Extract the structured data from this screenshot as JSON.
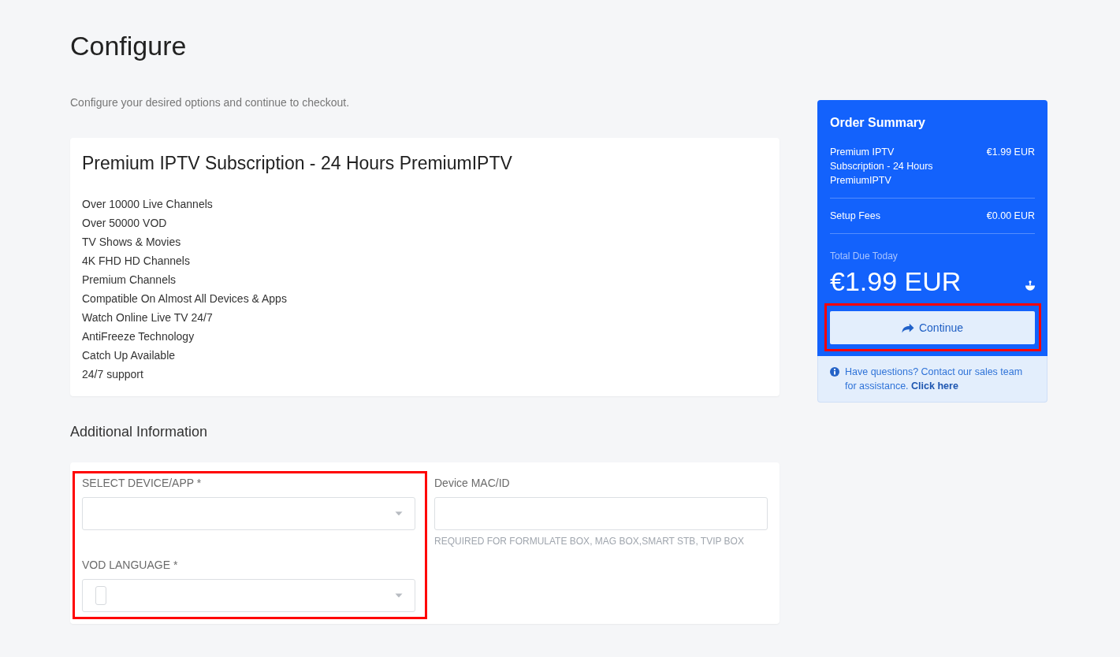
{
  "header": {
    "title": "Configure",
    "subtitle": "Configure your desired options and continue to checkout."
  },
  "product": {
    "title": "Premium IPTV Subscription - 24 Hours PremiumIPTV",
    "features": [
      "Over 10000 Live Channels",
      "Over 50000 VOD",
      "TV Shows & Movies",
      "4K FHD HD Channels",
      "Premium Channels",
      "Compatible On Almost All Devices & Apps",
      "Watch Online Live TV 24/7",
      "AntiFreeze Technology",
      "Catch Up Available",
      "24/7 support"
    ]
  },
  "additional_information": {
    "heading": "Additional Information",
    "columns": [
      {
        "highlighted": true,
        "fields": [
          {
            "kind": "select",
            "label": "SELECT DEVICE/APP *"
          },
          {
            "kind": "flagselect",
            "label": "VOD LANGUAGE *"
          }
        ]
      },
      {
        "highlighted": false,
        "fields": [
          {
            "kind": "text",
            "label": "Device MAC/ID",
            "hint": "REQUIRED FOR FORMULATE BOX, MAG BOX,SMART STB, TVIP BOX"
          }
        ]
      }
    ]
  },
  "order_summary": {
    "title": "Order Summary",
    "lines": [
      {
        "label": "Premium IPTV Subscription - 24 Hours PremiumIPTV",
        "amount": "€1.99 EUR"
      },
      {
        "label": "Setup Fees",
        "amount": "€0.00 EUR"
      }
    ],
    "total_label": "Total Due Today",
    "total": "€1.99 EUR",
    "continue_button": {
      "label": "Continue",
      "highlighted": true
    }
  },
  "help": {
    "text": "Have questions? Contact our sales team for assistance.",
    "link": "Click here"
  }
}
